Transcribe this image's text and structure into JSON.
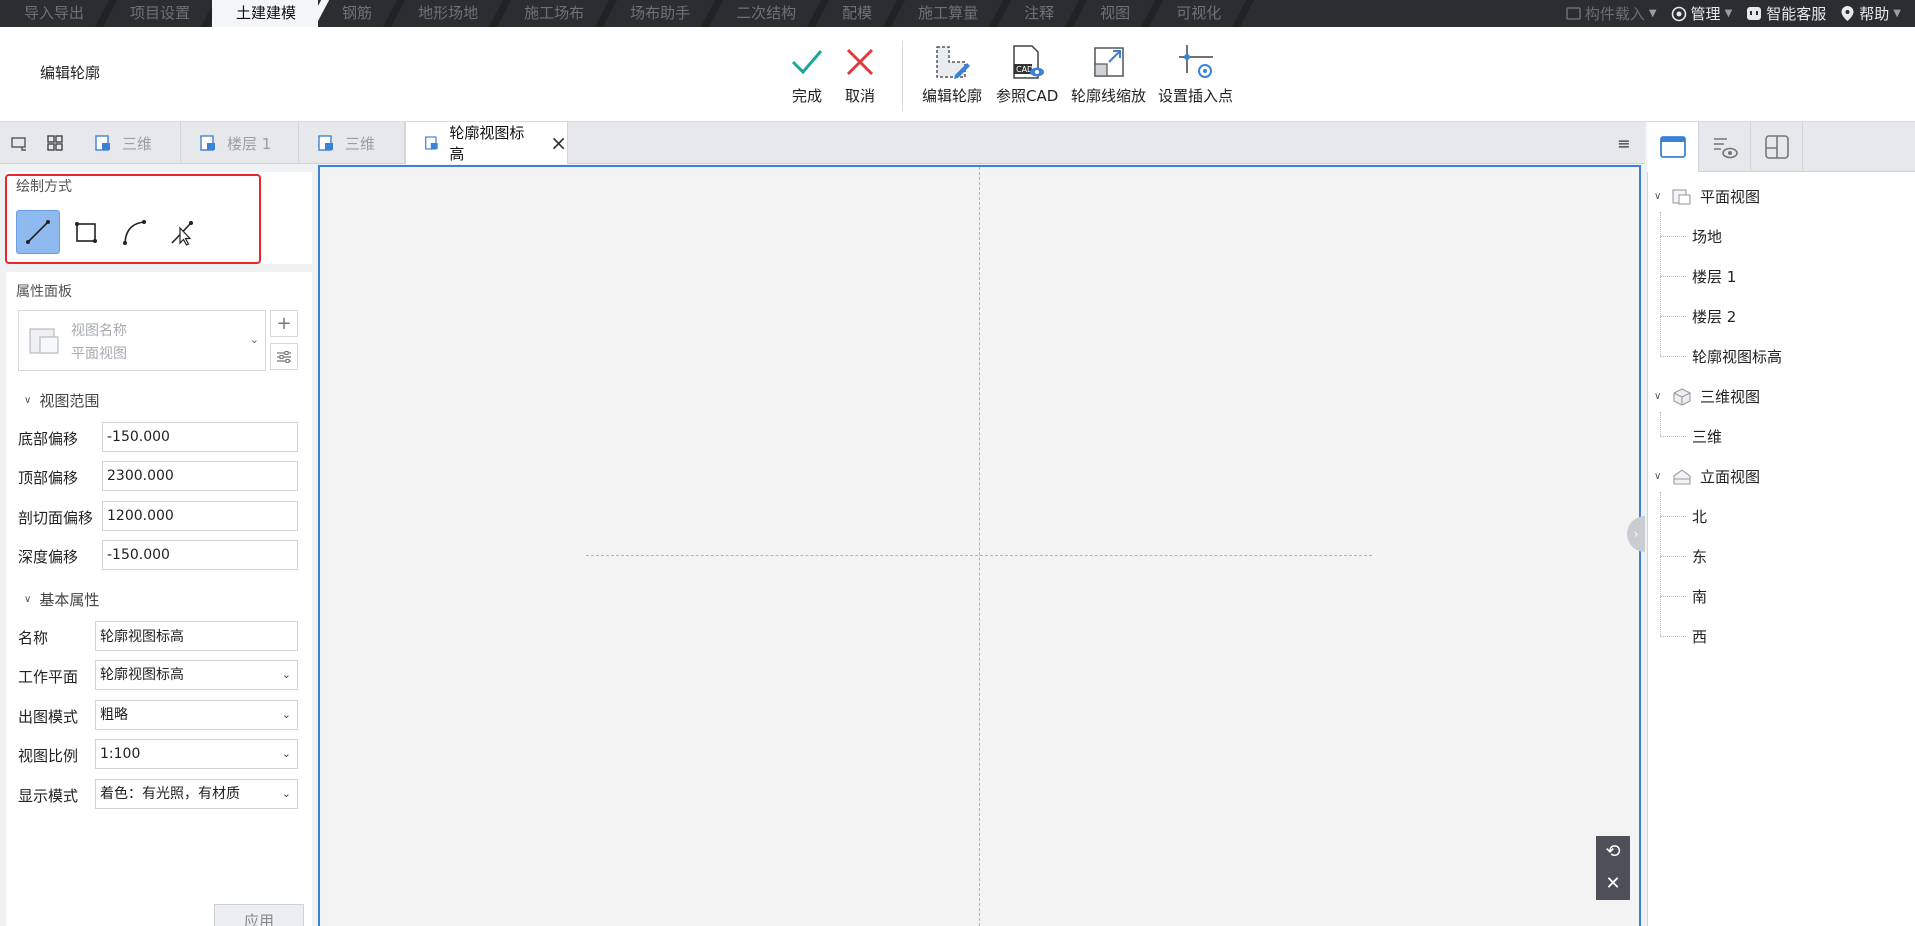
{
  "menubar": {
    "tabs": [
      "导入导出",
      "项目设置",
      "土建建模",
      "钢筋",
      "地形场地",
      "施工场布",
      "场布助手",
      "二次结构",
      "配模",
      "施工算量",
      "注释",
      "视图",
      "可视化"
    ],
    "active_tab": "土建建模",
    "right": {
      "component_load": "构件载入",
      "manage": "管理",
      "service": "智能客服",
      "help": "帮助"
    }
  },
  "ribbon": {
    "context_title": "编辑轮廓",
    "buttons": {
      "finish": "完成",
      "cancel": "取消",
      "edit_outline": "编辑轮廓",
      "ref_cad": "参照CAD",
      "outline_scale": "轮廓线缩放",
      "set_insert_point": "设置插入点"
    }
  },
  "view_tabs": {
    "tabs": [
      "三维",
      "楼层 1",
      "三维",
      "轮廓视图标高"
    ],
    "active": "轮廓视图标高"
  },
  "draw_mode": {
    "title": "绘制方式",
    "tools": [
      "line",
      "rectangle",
      "arc",
      "pick"
    ]
  },
  "properties": {
    "title": "属性面板",
    "view_name_label": "视图名称",
    "view_name_value": "平面视图",
    "view_range": {
      "title": "视图范围",
      "fields": [
        {
          "label": "底部偏移",
          "value": "-150.000"
        },
        {
          "label": "顶部偏移",
          "value": "2300.000"
        },
        {
          "label": "剖切面偏移",
          "value": "1200.000"
        },
        {
          "label": "深度偏移",
          "value": "-150.000"
        }
      ]
    },
    "basic": {
      "title": "基本属性",
      "name_label": "名称",
      "name_value": "轮廓视图标高",
      "selects": [
        {
          "label": "工作平面",
          "value": "轮廓视图标高"
        },
        {
          "label": "出图模式",
          "value": "粗略"
        },
        {
          "label": "视图比例",
          "value": "1:100"
        },
        {
          "label": "显示模式",
          "value": "着色：有光照，有材质"
        }
      ]
    },
    "apply": "应用"
  },
  "view_tree": {
    "plan": {
      "label": "平面视图",
      "children": [
        "场地",
        "楼层 1",
        "楼层 2",
        "轮廓视图标高"
      ]
    },
    "three_d": {
      "label": "三维视图",
      "children": [
        "三维"
      ]
    },
    "elevation": {
      "label": "立面视图",
      "children": [
        "北",
        "东",
        "南",
        "西"
      ]
    }
  },
  "colors": {
    "accent": "#3b82d6",
    "highlight_box": "#e8262b",
    "finish_check": "#1aa89a",
    "cancel_x": "#e23a3a"
  }
}
